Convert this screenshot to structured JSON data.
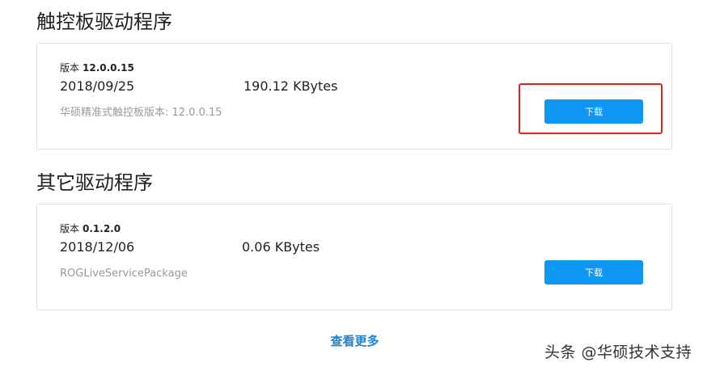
{
  "touchpad_section": {
    "title": "触控板驱动程序",
    "driver": {
      "version_label": "版本",
      "version": "12.0.0.15",
      "date": "2018/09/25",
      "size": "190.12 KBytes",
      "description": "华硕精准式触控板版本: 12.0.0.15",
      "download_label": "下载"
    }
  },
  "other_section": {
    "title": "其它驱动程序",
    "driver": {
      "version_label": "版本",
      "version": "0.1.2.0",
      "date": "2018/12/06",
      "size": "0.06 KBytes",
      "description": "ROGLiveServicePackage",
      "download_label": "下载"
    }
  },
  "more_link": "查看更多",
  "watermark": "头条 @华硕技术支持",
  "colors": {
    "button": "#0d96f2",
    "highlight": "#e2231a",
    "link": "#1a86d6"
  }
}
